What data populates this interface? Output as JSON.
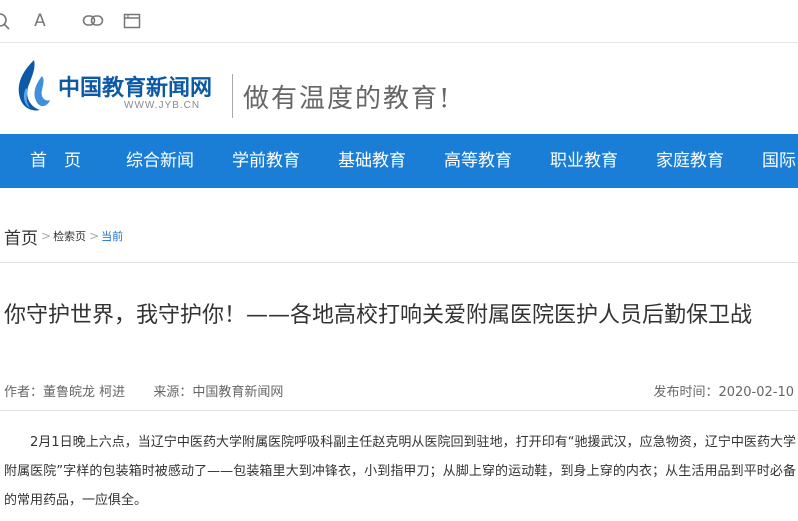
{
  "toolbar": {
    "icons": [
      "search-icon",
      "font-size-icon",
      "link-icon",
      "window-icon"
    ],
    "font_glyph": "A"
  },
  "header": {
    "site_name": "中国教育新闻网",
    "site_url": "WWW.JYB.CN",
    "slogan": "做有温度的教育!",
    "brand_color": "#0c5aa6"
  },
  "nav": {
    "background": "#1a7ed6",
    "items": [
      "首　页",
      "综合新闻",
      "学前教育",
      "基础教育",
      "高等教育",
      "职业教育",
      "家庭教育",
      "国际"
    ]
  },
  "breadcrumb": {
    "home": "首页",
    "search": "检索页",
    "current": "当前"
  },
  "article": {
    "title": "你守护世界，我守护你！——各地高校打响关爱附属医院医护人员后勤保卫战",
    "author": "作者：董鲁皖龙 柯进",
    "source": "来源：中国教育新闻网",
    "publish_time": "发布时间：2020-02-10",
    "paragraph": "2月1日晚上六点，当辽宁中医药大学附属医院呼吸科副主任赵克明从医院回到驻地，打开印有“驰援武汉，应急物资，辽宁中医药大学附属医院”字样的包装箱时被感动了——包装箱里大到冲锋衣，小到指甲刀；从脚上穿的运动鞋，到身上穿的内衣；从生活用品到平时必备的常用药品，一应俱全。"
  }
}
